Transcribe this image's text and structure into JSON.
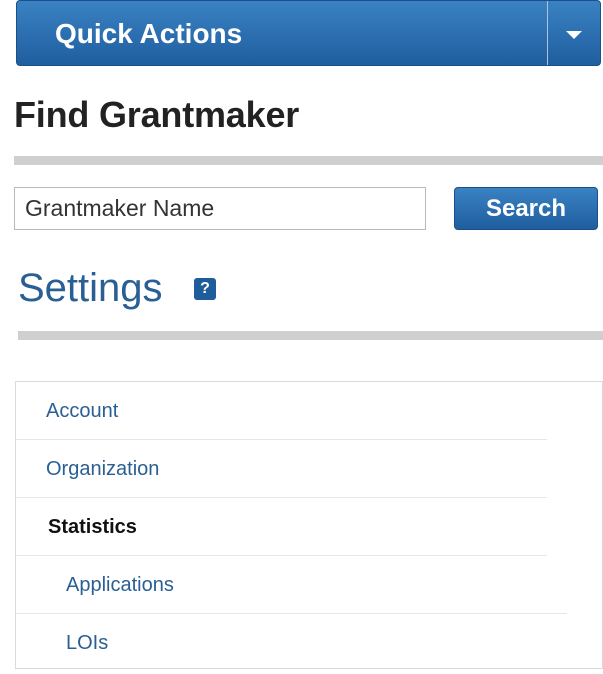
{
  "quick_actions": {
    "label": "Quick Actions",
    "toggle_icon": "chevron-down-icon"
  },
  "find_grantmaker": {
    "title": "Find Grantmaker",
    "input_value": "Grantmaker Name",
    "search_label": "Search"
  },
  "settings": {
    "title": "Settings",
    "help_glyph": "?",
    "menu": [
      {
        "label": "Account"
      },
      {
        "label": "Organization"
      },
      {
        "label": "Statistics",
        "active": true
      },
      {
        "label": "Applications"
      },
      {
        "label": "LOIs"
      }
    ]
  },
  "colors": {
    "accent": "#1f5e9f",
    "link": "#2a5f93",
    "rule": "#cfcfcf"
  }
}
